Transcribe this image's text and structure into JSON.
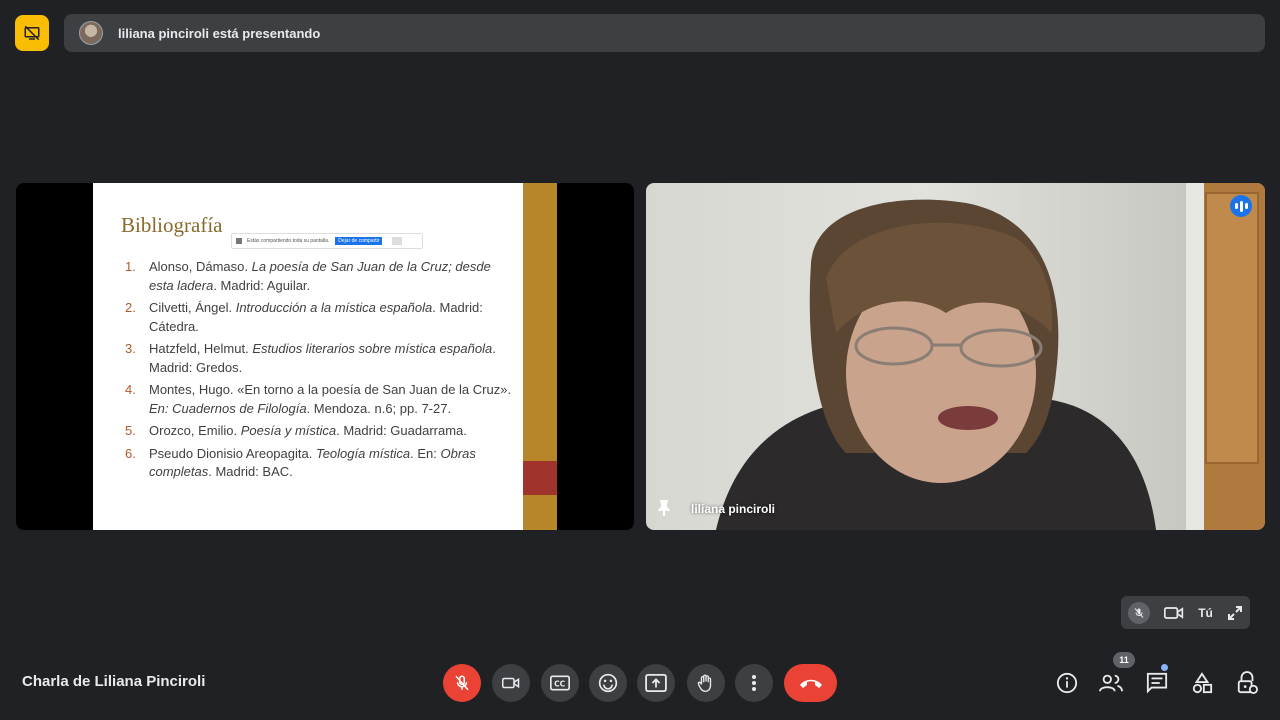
{
  "header": {
    "presenting_text": "liliana pinciroli está presentando"
  },
  "slide": {
    "title": "Bibliografía",
    "share_bar": {
      "message": "Estás compartiendo toda su pantalla.",
      "stop_label": "Dejar de compartir",
      "hide_label": "..."
    },
    "items": [
      {
        "num": "1.",
        "parts": [
          [
            "n",
            "Alonso, Dámaso. "
          ],
          [
            "i",
            "La poesía de San Juan de la Cruz; desde esta ladera"
          ],
          [
            "n",
            ". Madrid: Aguilar."
          ]
        ]
      },
      {
        "num": "2.",
        "parts": [
          [
            "n",
            "Cilvetti, Ángel. "
          ],
          [
            "i",
            "Introducción a la mística española"
          ],
          [
            "n",
            ". Madrid: Cátedra."
          ]
        ]
      },
      {
        "num": "3.",
        "parts": [
          [
            "n",
            "Hatzfeld, Helmut. "
          ],
          [
            "i",
            "Estudios literarios sobre mística española"
          ],
          [
            "n",
            ". Madrid: Gredos."
          ]
        ]
      },
      {
        "num": "4.",
        "parts": [
          [
            "n",
            "Montes, Hugo. «En torno a la poesía de San Juan de la Cruz». "
          ],
          [
            "i",
            "En: Cuadernos de Filología"
          ],
          [
            "n",
            ". Mendoza. n.6;  pp. 7-27."
          ]
        ]
      },
      {
        "num": "5.",
        "parts": [
          [
            "n",
            "Orozco, Emilio. "
          ],
          [
            "i",
            "Poesía y mística"
          ],
          [
            "n",
            ". Madrid: Guadarrama."
          ]
        ]
      },
      {
        "num": "6.",
        "parts": [
          [
            "n",
            "Pseudo Dionisio Areopagita. "
          ],
          [
            "i",
            "Teología mística"
          ],
          [
            "n",
            ". En: "
          ],
          [
            "i",
            "Obras completas"
          ],
          [
            "n",
            ". Madrid: BAC."
          ]
        ]
      }
    ]
  },
  "participant": {
    "name": "liliana pinciroli"
  },
  "self_view": {
    "label": "Tú"
  },
  "bottom_bar": {
    "meeting_title": "Charla de Liliana Pinciroli",
    "participant_count": "11"
  },
  "colors": {
    "background": "#202124",
    "present_accent": "#fbbc04",
    "danger": "#ea4335",
    "speaking": "#1a73e8"
  },
  "icons": [
    "stop-presenting-icon",
    "mic-off-icon",
    "camera-icon",
    "captions-icon",
    "emoji-icon",
    "present-icon",
    "raise-hand-icon",
    "more-options-icon",
    "hang-up-icon",
    "info-icon",
    "people-icon",
    "chat-icon",
    "activities-icon",
    "host-controls-icon",
    "pin-icon",
    "expand-icon"
  ]
}
